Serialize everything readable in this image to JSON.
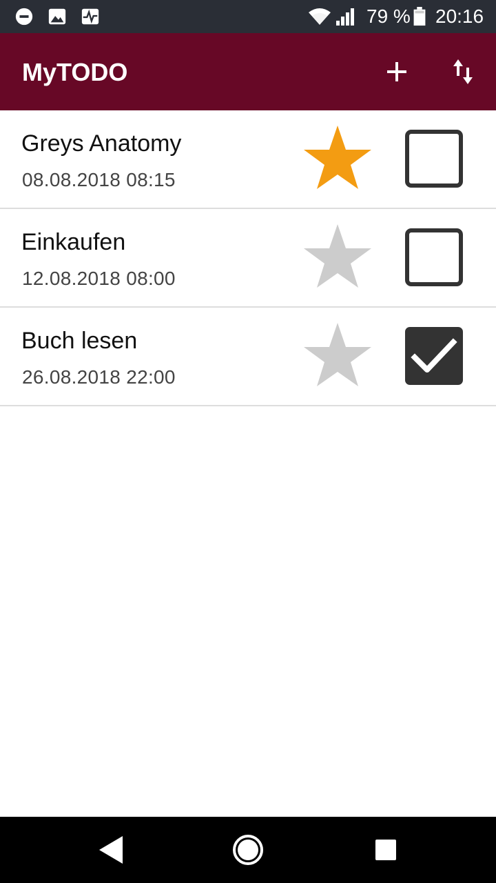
{
  "status_bar": {
    "battery_text": "79 %",
    "time": "20:16",
    "icons": [
      "do-not-disturb-icon",
      "image-icon",
      "activity-icon",
      "wifi-icon",
      "signal-icon",
      "battery-icon"
    ]
  },
  "app_bar": {
    "title": "MyTODO",
    "actions": [
      "add-icon",
      "sort-icon"
    ],
    "background": "#670826"
  },
  "todos": [
    {
      "title": "Greys Anatomy",
      "date": "08.08.2018 08:15",
      "favorite": true,
      "done": false
    },
    {
      "title": "Einkaufen",
      "date": "12.08.2018 08:00",
      "favorite": false,
      "done": false
    },
    {
      "title": "Buch lesen",
      "date": "26.08.2018 22:00",
      "favorite": false,
      "done": true
    }
  ],
  "colors": {
    "star_active": "#f39c12",
    "star_inactive": "#cccccc",
    "checkbox": "#333333"
  },
  "nav_bar": {
    "buttons": [
      "back-icon",
      "home-icon",
      "recents-icon"
    ]
  }
}
